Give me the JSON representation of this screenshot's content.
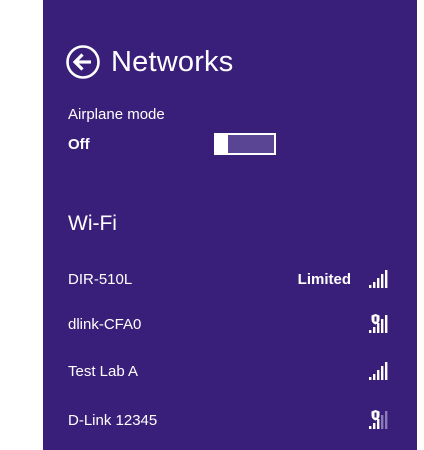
{
  "header": {
    "title": "Networks",
    "back_icon": "back-arrow-circle-icon"
  },
  "airplane": {
    "label": "Airplane mode",
    "state": "Off",
    "enabled": false
  },
  "wifi": {
    "section_title": "Wi-Fi",
    "networks": [
      {
        "name": "DIR-510L",
        "status": "Limited",
        "secured": false,
        "signal_bars": 5,
        "icon": "wifi-signal-icon"
      },
      {
        "name": "dlink-CFA0",
        "status": "",
        "secured": true,
        "signal_bars": 5,
        "icon": "wifi-secured-signal-icon"
      },
      {
        "name": "Test Lab A",
        "status": "",
        "secured": false,
        "signal_bars": 5,
        "icon": "wifi-signal-icon"
      },
      {
        "name": "D-Link 12345",
        "status": "",
        "secured": true,
        "signal_bars": 3,
        "icon": "wifi-secured-signal-icon"
      }
    ]
  },
  "colors": {
    "panel_background": "#3a1f7a",
    "text": "#ffffff",
    "toggle_track": "#5a4494"
  }
}
